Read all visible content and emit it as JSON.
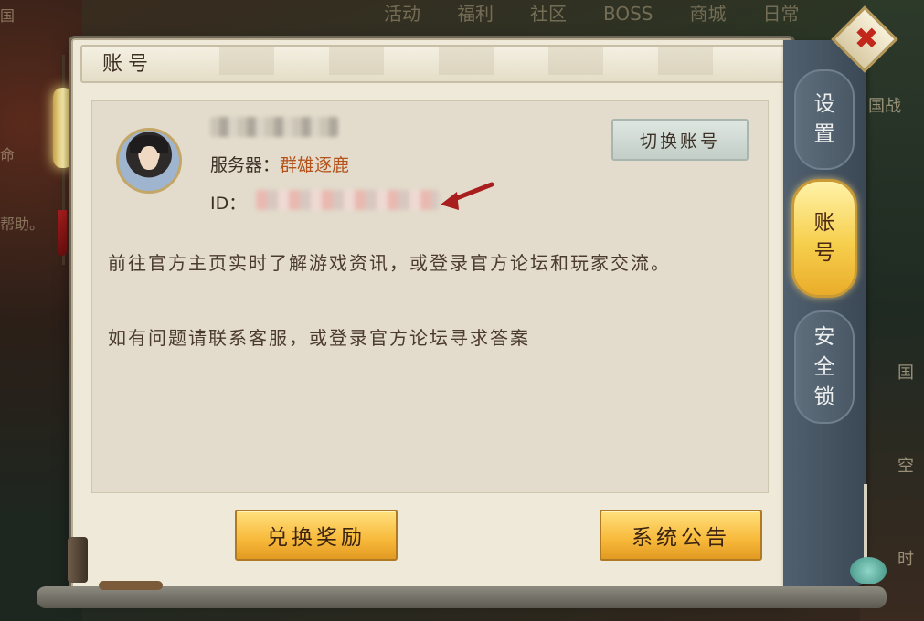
{
  "hud": {
    "top_menu": [
      "活动",
      "福利",
      "社区",
      "BOSS",
      "商城",
      "日常"
    ],
    "left_texts": [
      "国",
      "命",
      "帮助。"
    ],
    "right_texts": [
      "国战",
      "国",
      "空",
      "时"
    ]
  },
  "dialog": {
    "title": "账号",
    "profile": {
      "server_label": "服务器：",
      "server_value": "群雄逐鹿",
      "id_label": "ID："
    },
    "switch_account_label": "切换账号",
    "info_line_1": "前往官方主页实时了解游戏资讯，或登录官方论坛和玩家交流。",
    "info_line_2": "如有问题请联系客服，或登录官方论坛寻求答案",
    "redeem_button": "兑换奖励",
    "announcement_button": "系统公告"
  },
  "tabs": [
    {
      "chars": [
        "设",
        "置"
      ],
      "active": false
    },
    {
      "chars": [
        "账",
        "号"
      ],
      "active": true
    },
    {
      "chars": [
        "安",
        "全",
        "锁"
      ],
      "active": false
    }
  ],
  "colors": {
    "server_value": "#b4521a",
    "arrow": "#a81d1d",
    "close_x": "#c2271c",
    "gold_button": "#f7b93a"
  },
  "icons": {
    "close": "close-icon",
    "avatar": "avatar-image",
    "arrow": "red-arrow-annotation"
  }
}
